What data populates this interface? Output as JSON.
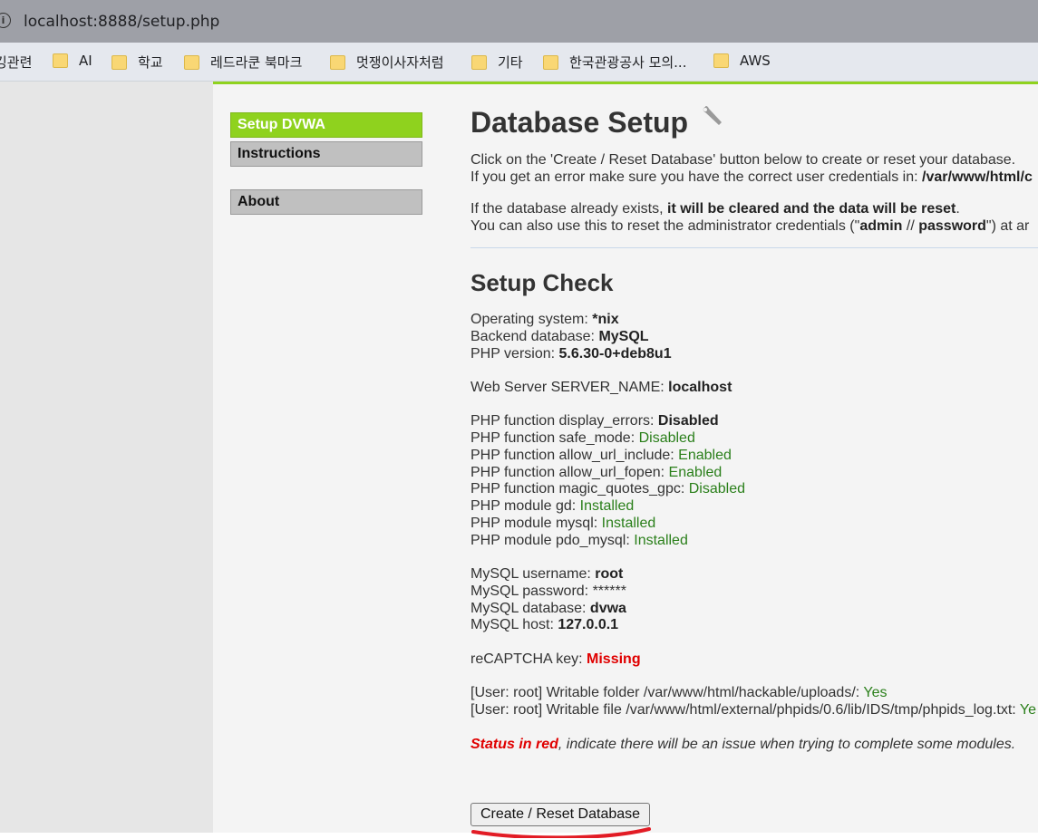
{
  "browser": {
    "url": "localhost:8888/setup.php"
  },
  "bookmarks": [
    "깅관련",
    "AI",
    "학교",
    "레드라쿤 북마크",
    "멋쟁이사자처럼",
    "기타",
    "한국관광공사 모의...",
    "AWS"
  ],
  "menu": {
    "setup": "Setup DVWA",
    "instructions": "Instructions",
    "about": "About"
  },
  "header": {
    "title": "Database Setup",
    "p1a": "Click on the 'Create / Reset Database' button below to create or reset your database.",
    "p1b_pre": "If you get an error make sure you have the correct user credentials in: ",
    "p1b_path": "/var/www/html/c",
    "p2a_pre": "If the database already exists, ",
    "p2a_bold": "it will be cleared and the data will be reset",
    "p2a_post": ".",
    "p2b_pre": "You can also use this to reset the administrator credentials (\"",
    "p2b_admin": "admin",
    "p2b_sep": " // ",
    "p2b_pw": "password",
    "p2b_post": "\") at ar"
  },
  "setup_check": {
    "title": "Setup Check",
    "os_label": "Operating system: ",
    "os_value": "*nix",
    "db_label": "Backend database: ",
    "db_value": "MySQL",
    "php_label": "PHP version: ",
    "php_value": "5.6.30-0+deb8u1",
    "server_label": "Web Server SERVER_NAME: ",
    "server_value": "localhost",
    "f1_label": "PHP function display_errors: ",
    "f1_value": "Disabled",
    "f2_label": "PHP function safe_mode: ",
    "f2_value": "Disabled",
    "f3_label": "PHP function allow_url_include: ",
    "f3_value": "Enabled",
    "f4_label": "PHP function allow_url_fopen: ",
    "f4_value": "Enabled",
    "f5_label": "PHP function magic_quotes_gpc: ",
    "f5_value": "Disabled",
    "m1_label": "PHP module gd: ",
    "m1_value": "Installed",
    "m2_label": "PHP module mysql: ",
    "m2_value": "Installed",
    "m3_label": "PHP module pdo_mysql: ",
    "m3_value": "Installed",
    "u_label": "MySQL username: ",
    "u_value": "root",
    "pw_label": "MySQL password: ",
    "pw_value": "******",
    "d_label": "MySQL database: ",
    "d_value": "dvwa",
    "h_label": "MySQL host: ",
    "h_value": "127.0.0.1",
    "recaptcha_label": "reCAPTCHA key: ",
    "recaptcha_value": "Missing",
    "w1_label": "[User: root] Writable folder /var/www/html/hackable/uploads/: ",
    "w1_value": "Yes",
    "w2_label": "[User: root] Writable file /var/www/html/external/phpids/0.6/lib/IDS/tmp/phpids_log.txt: ",
    "w2_value": "Ye",
    "status_red": "Status in red",
    "status_rest": ", indicate there will be an issue when trying to complete some modules."
  },
  "button": {
    "label": "Create / Reset Database"
  },
  "colors": {
    "accent": "#8fd21e",
    "ok": "#2a7f1a",
    "error": "#e00000"
  }
}
